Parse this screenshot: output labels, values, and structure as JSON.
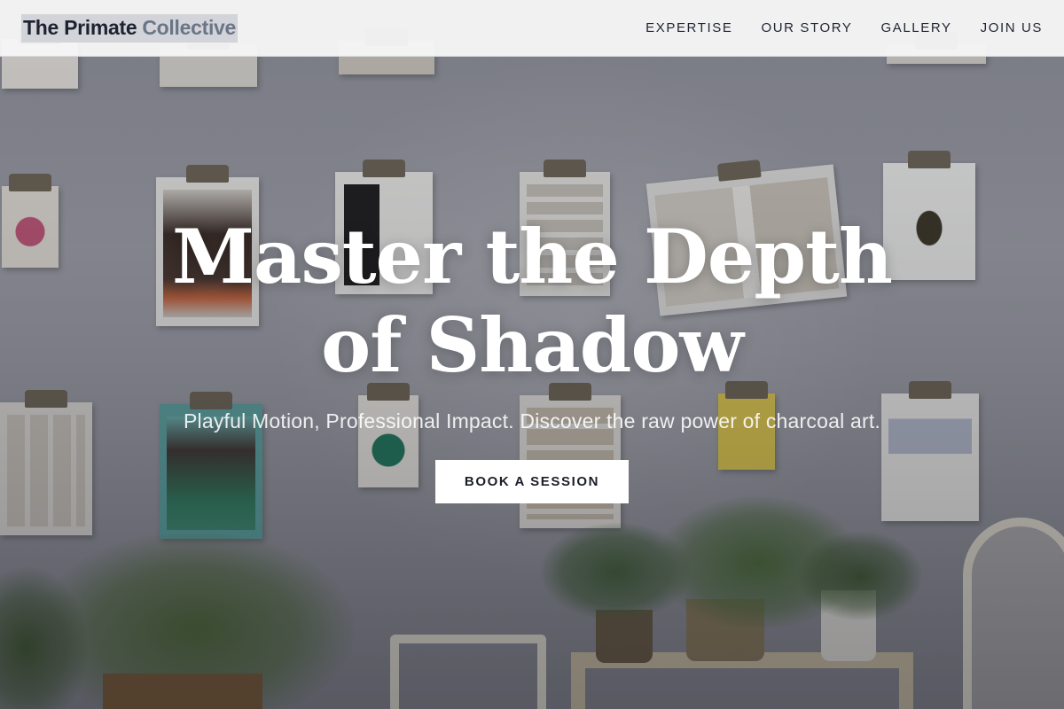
{
  "brand": {
    "main": "The Primate",
    "accent": "Collective"
  },
  "nav": {
    "items": [
      "EXPERTISE",
      "OUR STORY",
      "GALLERY",
      "JOIN US"
    ]
  },
  "hero": {
    "title_line1": "Master the Depth",
    "title_line2": "of Shadow",
    "subtitle": "Playful Motion, Professional Impact. Discover the raw power of charcoal art.",
    "cta_label": "BOOK A SESSION"
  },
  "colors": {
    "nav_bg": "#f6f6f7",
    "brand_dark": "#1d2230",
    "brand_accent": "#6a7586",
    "cta_bg": "#ffffff",
    "cta_text": "#1b1e27"
  }
}
